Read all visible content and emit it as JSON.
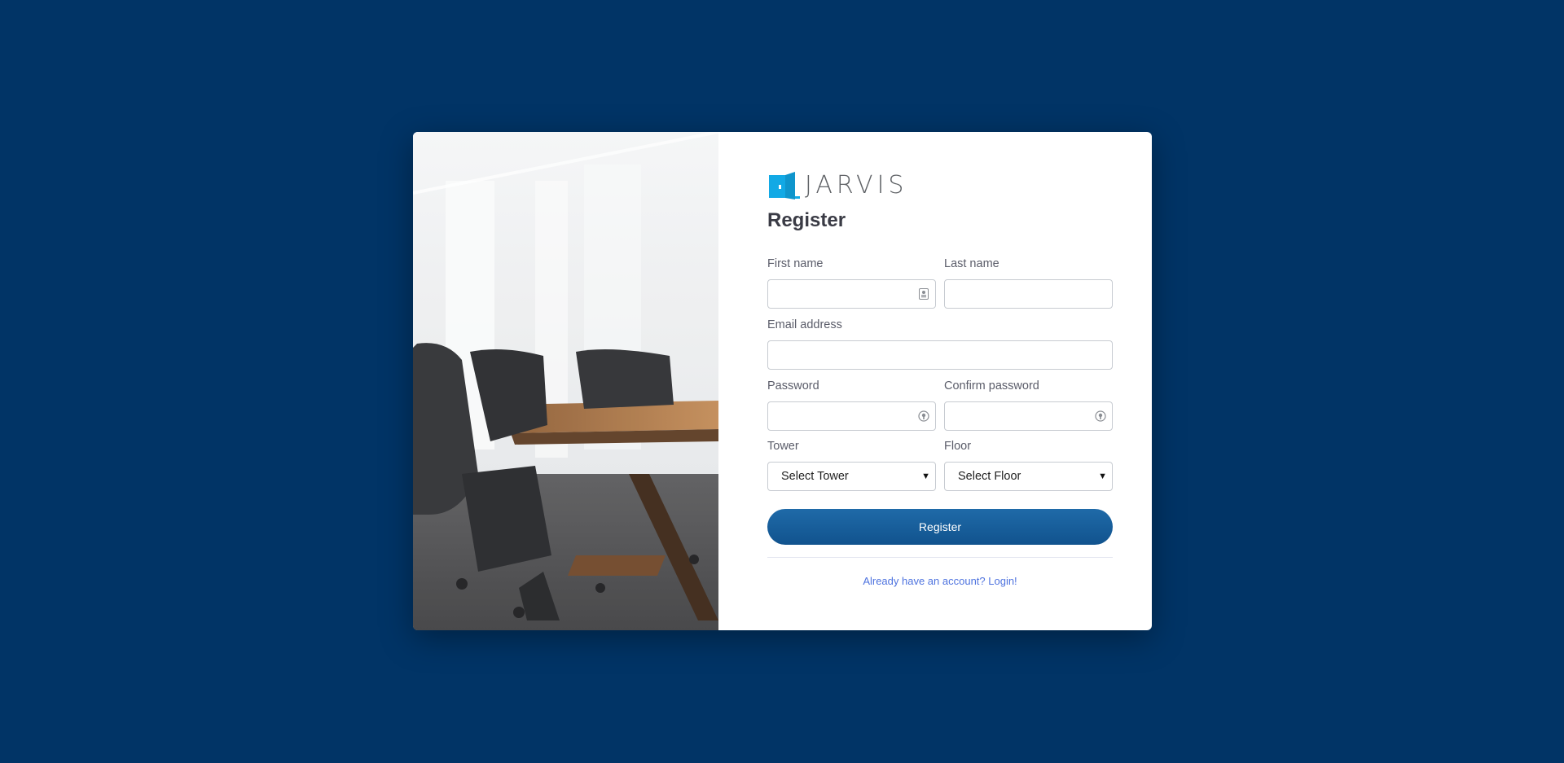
{
  "brand": {
    "name": "JARVIS",
    "accent": "#12a9e5"
  },
  "form": {
    "title": "Register",
    "first_name": {
      "label": "First name",
      "value": "",
      "placeholder": ""
    },
    "last_name": {
      "label": "Last name",
      "value": "",
      "placeholder": ""
    },
    "email": {
      "label": "Email address",
      "value": "",
      "placeholder": ""
    },
    "password": {
      "label": "Password",
      "value": "",
      "placeholder": ""
    },
    "confirm_password": {
      "label": "Confirm password",
      "value": "",
      "placeholder": ""
    },
    "tower": {
      "label": "Tower",
      "selected": "Select Tower"
    },
    "floor": {
      "label": "Floor",
      "selected": "Select Floor"
    },
    "submit_label": "Register",
    "login_link": "Already have an account? Login!"
  },
  "colors": {
    "page_background": "#013466",
    "button": "#155c99",
    "link": "#4e73df"
  },
  "icons": {
    "first_name_field": "contact-card-icon",
    "password_field": "password-key-icon",
    "select_caret": "caret-down-icon"
  }
}
